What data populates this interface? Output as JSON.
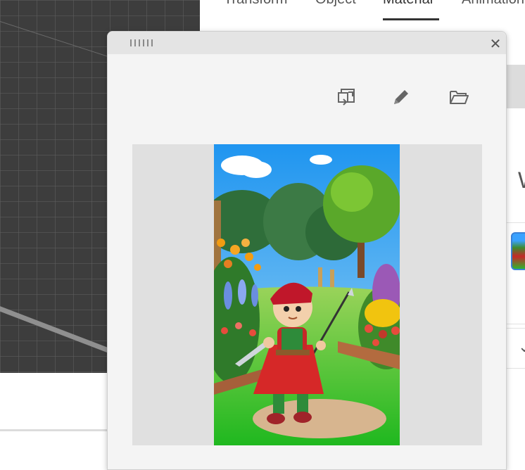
{
  "tabs": [
    {
      "label": "Transform"
    },
    {
      "label": "Object"
    },
    {
      "label": "Material",
      "active": true
    },
    {
      "label": "Animation"
    }
  ],
  "dialog": {
    "close_symbol": "✕",
    "toolbar": [
      {
        "icon": "replace-image-icon"
      },
      {
        "icon": "edit-pencil-icon"
      },
      {
        "icon": "open-folder-icon"
      }
    ],
    "image_subject": "cartoon-warrior-in-garden"
  },
  "panel": {
    "partial_glyph": "W",
    "chevron": "⌄"
  },
  "colors": {
    "viewport_bg": "#3d3d3d",
    "dialog_bg": "#f4f4f4",
    "header_bg": "#e4e4e4",
    "preview_bg": "#e0e0e0",
    "selection_accent": "#3b82d6",
    "active_tab_underline": "#333333"
  }
}
